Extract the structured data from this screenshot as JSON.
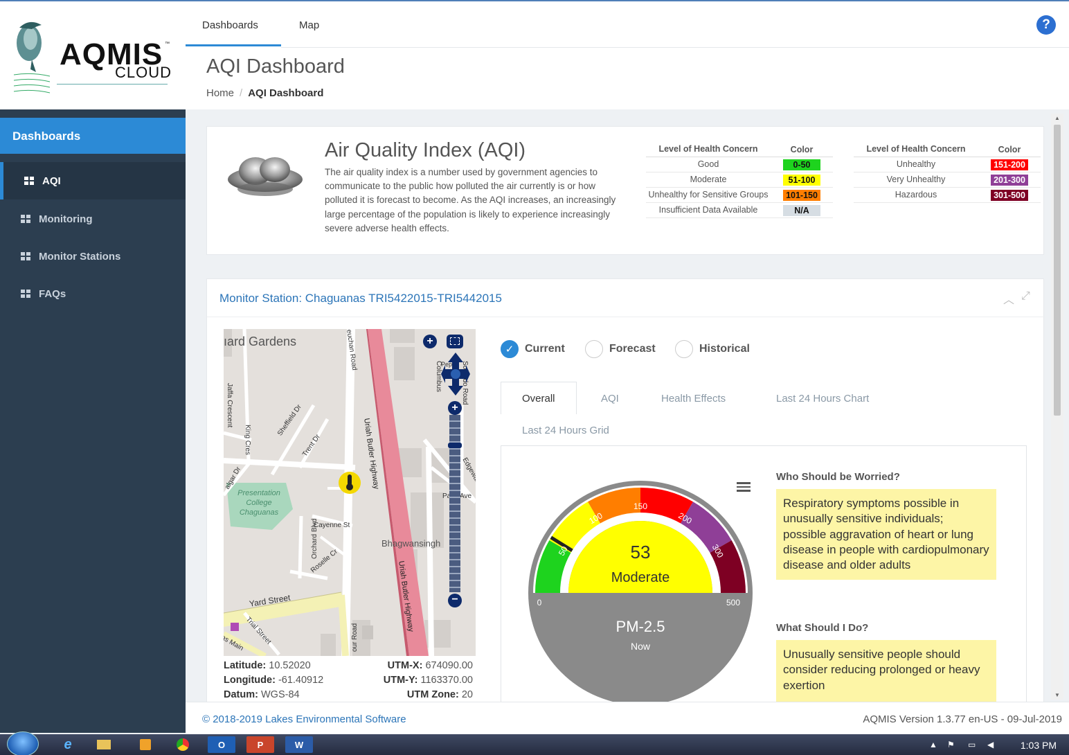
{
  "app": {
    "logo_name": "AQMIS",
    "logo_tm": "™",
    "logo_cloud": "CLOUD"
  },
  "nav": {
    "tabs": [
      "Dashboards",
      "Map"
    ],
    "help_label": "?"
  },
  "header": {
    "page_title": "AQI Dashboard",
    "breadcrumb": {
      "home": "Home",
      "sep": "/",
      "current": "AQI Dashboard"
    }
  },
  "sidebar": {
    "heading": "Dashboards",
    "items": [
      {
        "label": "AQI",
        "active": true
      },
      {
        "label": "Monitoring",
        "active": false
      },
      {
        "label": "Monitor Stations",
        "active": false
      },
      {
        "label": "FAQs",
        "active": false
      }
    ]
  },
  "aqi_card": {
    "title": "Air Quality Index (AQI)",
    "description": "The air quality index is a number used by government agencies to communicate to the public how polluted the air currently is or how polluted it is forecast to become. As the AQI increases, an increasingly large percentage of the population is likely to experience increasingly severe adverse health effects.",
    "col_headers": {
      "level": "Level of Health Concern",
      "color": "Color"
    },
    "levels_left": [
      {
        "level": "Good",
        "range": "0-50",
        "color": "#1ed31e"
      },
      {
        "level": "Moderate",
        "range": "51-100",
        "color": "#ffff00"
      },
      {
        "level": "Unhealthy for Sensitive Groups",
        "range": "101-150",
        "color": "#ff7e00"
      },
      {
        "level": "Insufficient Data Available",
        "range": "N/A",
        "color": "#d6dde3"
      }
    ],
    "levels_right": [
      {
        "level": "Unhealthy",
        "range": "151-200",
        "color": "#ff0000"
      },
      {
        "level": "Very Unhealthy",
        "range": "201-300",
        "color": "#8f3f97"
      },
      {
        "level": "Hazardous",
        "range": "301-500",
        "color": "#7e0023"
      }
    ]
  },
  "station": {
    "title": "Monitor Station: Chaguanas TRI5422015-TRI5442015",
    "map_labels": {
      "gardens": "ıard Gardens",
      "jaffa": "Jaffa Crescent",
      "king": "King Cres",
      "sheffield": "Sheffield Dr",
      "trent": "Trent Dr",
      "trafalgar": "algar Dr",
      "presentation": "Presentation College Chaguanas",
      "cayenne": "Cayenne St",
      "orchard": "Orchard Blvd",
      "roselle": "Roselle Cr",
      "yard": "Yard Street",
      "trial": "Trial Street",
      "main": "as Main",
      "uriah1": "Uriah Butler Highway",
      "uriah2": "Uriah Butler Highway",
      "bhagwansingh": "Bhagwansingh",
      "euchan": "euchan Road",
      "columbus": "Columbus",
      "solando": "Solando Road",
      "paris": "Paris Ave",
      "edgware": "Edgeware Circ",
      "our_road": "our Road",
      "pep": "Pep"
    },
    "coords": {
      "lat_label": "Latitude:",
      "lat": "10.52020",
      "lon_label": "Longitude:",
      "lon": "-61.40912",
      "datum_label": "Datum:",
      "datum": "WGS-84",
      "utmx_label": "UTM-X:",
      "utmx": "674090.00",
      "utmy_label": "UTM-Y:",
      "utmy": "1163370.00",
      "zone_label": "UTM Zone:",
      "zone": "20"
    },
    "modes": [
      {
        "label": "Current",
        "checked": true
      },
      {
        "label": "Forecast",
        "checked": false
      },
      {
        "label": "Historical",
        "checked": false
      }
    ],
    "tabs": [
      "Overall",
      "AQI",
      "Health Effects",
      "Last 24 Hours Chart",
      "Last 24 Hours Grid"
    ],
    "gauge": {
      "value": "53",
      "category": "Moderate",
      "pollutant": "PM-2.5",
      "period": "Now",
      "min": 0,
      "max": 500,
      "tick_labels": [
        "0",
        "50",
        "100",
        "150",
        "200",
        "300",
        "500"
      ]
    },
    "worried_title": "Who Should be Worried?",
    "worried_text": "Respiratory symptoms possible in unusually sensitive individuals; possible aggravation of heart or lung disease in people with cardiopulmonary disease and older adults",
    "do_title": "What Should I Do?",
    "do_text": "Unusually sensitive people should consider reducing prolonged or heavy exertion"
  },
  "footer": {
    "copyright": "© 2018-2019 Lakes Environmental Software",
    "version": "AQMIS Version 1.3.77 en-US - 09-Jul-2019"
  },
  "taskbar": {
    "clock": "1:03 PM",
    "apps": [
      "e",
      "",
      "",
      "",
      "O",
      "P",
      "W"
    ]
  }
}
